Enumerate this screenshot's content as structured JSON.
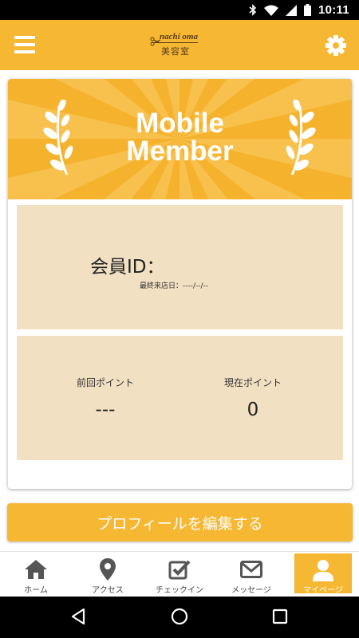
{
  "status_bar": {
    "time": "10:11"
  },
  "app_bar": {
    "logo_top": "nachi oma",
    "logo_bottom": "美容室"
  },
  "banner": {
    "title": "Mobile\nMember"
  },
  "member": {
    "id_label": "会員ID：",
    "last_visit": "最終来店日：----/--/--"
  },
  "points": {
    "previous_label": "前回ポイント",
    "previous_value": "---",
    "current_label": "現在ポイント",
    "current_value": "0"
  },
  "edit_profile_label": "プロフィールを編集する",
  "bottom_nav": {
    "items": [
      {
        "label": "ホーム",
        "icon": "home-icon"
      },
      {
        "label": "アクセス",
        "icon": "map-pin-icon"
      },
      {
        "label": "チェックイン",
        "icon": "checkbox-icon"
      },
      {
        "label": "メッセージ",
        "icon": "envelope-icon"
      },
      {
        "label": "マイページ",
        "icon": "user-icon",
        "active": true
      }
    ]
  },
  "colors": {
    "accent": "#f6b733",
    "panel": "#f2e0c2",
    "banner_ray_dark": "#f5b22c",
    "banner_ray_light": "#f8c04d"
  }
}
